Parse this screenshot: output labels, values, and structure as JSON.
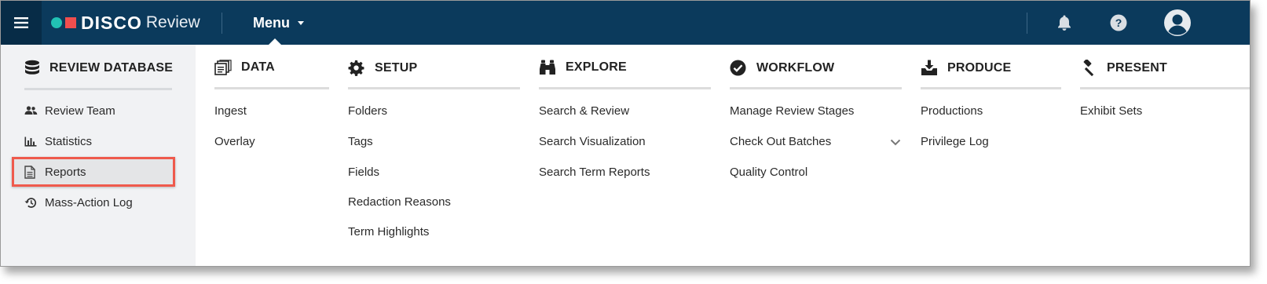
{
  "header": {
    "brand_primary": "DISCO",
    "brand_secondary": "Review",
    "menu_label": "Menu",
    "colors": {
      "bar": "#0b3a5c",
      "hamburger_bg": "#072c47",
      "brand_dot": "#21c1b4",
      "brand_square": "#f04e4e"
    }
  },
  "sidebar": {
    "heading": "REVIEW DATABASE",
    "items": [
      {
        "label": "Review Team",
        "icon": "users-icon"
      },
      {
        "label": "Statistics",
        "icon": "bar-chart-icon"
      },
      {
        "label": "Reports",
        "icon": "document-icon",
        "selected": true
      },
      {
        "label": "Mass-Action Log",
        "icon": "history-icon"
      }
    ]
  },
  "columns": [
    {
      "heading": "DATA",
      "icon": "data-stack-icon",
      "items": [
        "Ingest",
        "Overlay"
      ]
    },
    {
      "heading": "SETUP",
      "icon": "gear-icon",
      "items": [
        "Folders",
        "Tags",
        "Fields",
        "Redaction Reasons",
        "Term Highlights"
      ]
    },
    {
      "heading": "EXPLORE",
      "icon": "binoculars-icon",
      "items": [
        "Search & Review",
        "Search Visualization",
        "Search Term Reports"
      ]
    },
    {
      "heading": "WORKFLOW",
      "icon": "check-circle-icon",
      "items": [
        "Manage Review Stages",
        "Check Out Batches",
        "Quality Control"
      ]
    },
    {
      "heading": "PRODUCE",
      "icon": "download-tray-icon",
      "items": [
        "Productions",
        "Privilege Log"
      ]
    },
    {
      "heading": "PRESENT",
      "icon": "gavel-icon",
      "items": [
        "Exhibit Sets"
      ]
    }
  ],
  "highlight_color": "#ef5a4c"
}
